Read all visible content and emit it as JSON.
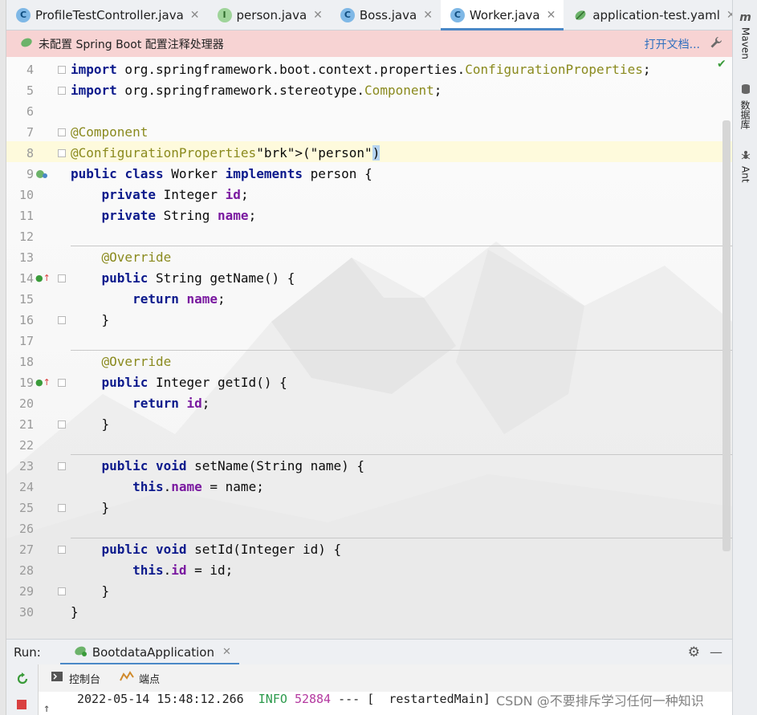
{
  "tabs": [
    {
      "label": "ProfileTestController.java",
      "icon": "class-icon",
      "active": false
    },
    {
      "label": "person.java",
      "icon": "interface-icon",
      "active": false
    },
    {
      "label": "Boss.java",
      "icon": "class-icon",
      "active": false
    },
    {
      "label": "Worker.java",
      "icon": "class-icon",
      "active": true
    },
    {
      "label": "application-test.yaml",
      "icon": "spring-leaf-icon",
      "active": false
    }
  ],
  "banner": {
    "message": "未配置 Spring Boot 配置注释处理器",
    "link": "打开文档..."
  },
  "code_lines": [
    {
      "n": "4",
      "text": "import org.springframework.boot.context.properties.ConfigurationProperties;"
    },
    {
      "n": "5",
      "text": "import org.springframework.stereotype.Component;"
    },
    {
      "n": "6",
      "text": ""
    },
    {
      "n": "7",
      "text": "@Component"
    },
    {
      "n": "8",
      "text": "@ConfigurationProperties(\"person\")"
    },
    {
      "n": "9",
      "text": "public class Worker implements person {"
    },
    {
      "n": "10",
      "text": "    private Integer id;"
    },
    {
      "n": "11",
      "text": "    private String name;"
    },
    {
      "n": "12",
      "text": ""
    },
    {
      "n": "13",
      "text": "    @Override"
    },
    {
      "n": "14",
      "text": "    public String getName() {"
    },
    {
      "n": "15",
      "text": "        return name;"
    },
    {
      "n": "16",
      "text": "    }"
    },
    {
      "n": "17",
      "text": ""
    },
    {
      "n": "18",
      "text": "    @Override"
    },
    {
      "n": "19",
      "text": "    public Integer getId() {"
    },
    {
      "n": "20",
      "text": "        return id;"
    },
    {
      "n": "21",
      "text": "    }"
    },
    {
      "n": "22",
      "text": ""
    },
    {
      "n": "23",
      "text": "    public void setName(String name) {"
    },
    {
      "n": "24",
      "text": "        this.name = name;"
    },
    {
      "n": "25",
      "text": "    }"
    },
    {
      "n": "26",
      "text": ""
    },
    {
      "n": "27",
      "text": "    public void setId(Integer id) {"
    },
    {
      "n": "28",
      "text": "        this.id = id;"
    },
    {
      "n": "29",
      "text": "    }"
    },
    {
      "n": "30",
      "text": "}"
    }
  ],
  "right_tools": [
    {
      "label": "Maven",
      "icon": "maven-icon"
    },
    {
      "label": "数据库",
      "icon": "database-icon"
    },
    {
      "label": "Ant",
      "icon": "ant-icon"
    }
  ],
  "run": {
    "label": "Run:",
    "config": "BootdataApplication",
    "console_tab": "控制台",
    "breakpoints_tab": "端点",
    "log_date": "2022-05-14 15:48:12.266",
    "log_level": "INFO",
    "log_pid": "52884",
    "log_rest": "--- [  restartedMain]"
  },
  "watermark": "CSDN @不要排斥学习任何一种知识",
  "colors": {
    "keyword": "#0c1a8c",
    "annotation": "#8a8a1e",
    "string": "#0d7a13",
    "field": "#7a1aa0",
    "banner_bg": "#f7d3d3",
    "accent": "#4a88c7"
  }
}
